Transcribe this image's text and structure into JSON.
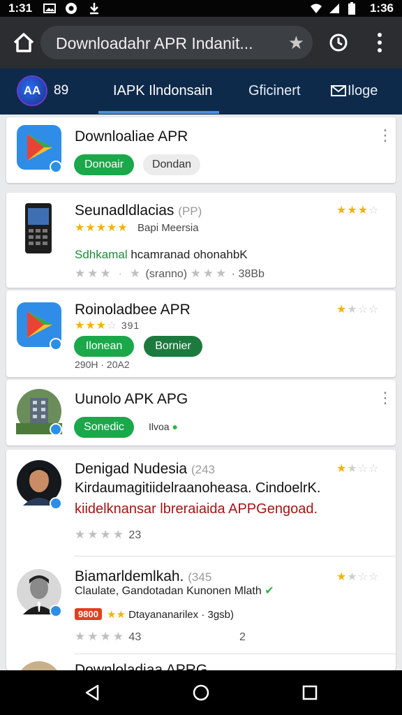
{
  "status_bar": {
    "time_left": "1:31",
    "time_right": "1:36"
  },
  "browser": {
    "url_text": "Downloadahr APR Indanit...",
    "icons": [
      "home-icon",
      "star-icon",
      "history-icon",
      "more-vert-icon"
    ]
  },
  "site_nav": {
    "logo_text": "AA",
    "number": "89",
    "tabs": [
      {
        "label": "IAPK Ilndonsain",
        "active": true
      },
      {
        "label": "Gficinert"
      },
      {
        "label": "Iloge",
        "icon": "mail-icon"
      }
    ]
  },
  "items": [
    {
      "title": "Downloaliae APR",
      "icon": "play-store-icon",
      "buttons": [
        "Donoair",
        "Dondan"
      ]
    },
    {
      "title": "Seunadldlacias",
      "title_suffix": "(PP)",
      "subtitle": "Bapi Meersia",
      "description": "Sdhkamal hcamranad ohonahbK",
      "review_count": "(sranno)",
      "meta": "· 38Bb",
      "icon": "phone-icon"
    },
    {
      "title": "Roinoladbee APR",
      "rating_count": "391",
      "buttons": [
        "Ilonean",
        "Bornier"
      ],
      "meta": "290H · 20A2",
      "icon": "play-store-icon"
    },
    {
      "title": "Uunolo APK APG",
      "button": "Sonedic",
      "extra": "Ilvoa",
      "icon": "building-icon"
    },
    {
      "title": "Denigad Nudesia",
      "title_suffix": "(243",
      "line1": "Kirdaumagitiidelraanoheasa. CindoelrK.",
      "line2": "kiidelknansar lbreraiaida APPGengoad.",
      "meta": "23",
      "icon": "avatar-man-icon"
    },
    {
      "title": "Biamarldemlkah.",
      "title_suffix": "(345",
      "subtitle": "Claulate, Gandotadan Kunonen Mlath",
      "badge": "9800",
      "line": "Dtayananarilex",
      "meta_right": "· 3gsb)",
      "meta": "43",
      "meta2": "2",
      "icon": "avatar-man-icon"
    },
    {
      "title": "Downloladiaa APRG"
    }
  ],
  "colors": {
    "green": "#1aa84a",
    "navy": "#0e2a4b",
    "gold": "#f0b400",
    "red_text": "#a31515"
  }
}
